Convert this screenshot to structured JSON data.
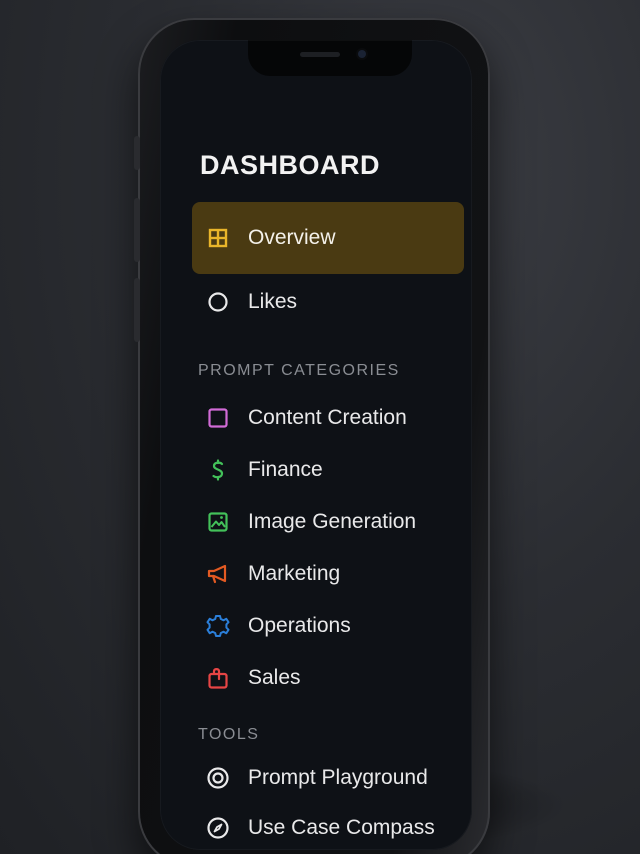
{
  "dashboard": {
    "title": "DASHBOARD"
  },
  "nav": {
    "items": [
      {
        "label": "Overview",
        "icon": "grid-icon",
        "active": true,
        "color": "#e9b52a"
      },
      {
        "label": "Likes",
        "icon": "circle-icon",
        "active": false,
        "color": "#e9e9ea"
      }
    ]
  },
  "categories": {
    "heading": "PROMPT CATEGORIES",
    "items": [
      {
        "label": "Content Creation",
        "icon": "square-icon",
        "color": "#d16bd6"
      },
      {
        "label": "Finance",
        "icon": "dollar-icon",
        "color": "#43c15a"
      },
      {
        "label": "Image Generation",
        "icon": "image-icon",
        "color": "#43c15a"
      },
      {
        "label": "Marketing",
        "icon": "megaphone-icon",
        "color": "#e35a22"
      },
      {
        "label": "Operations",
        "icon": "gear-icon",
        "color": "#2b7fd9"
      },
      {
        "label": "Sales",
        "icon": "bag-icon",
        "color": "#e64545"
      }
    ]
  },
  "tools": {
    "heading": "TOOLS",
    "items": [
      {
        "label": "Prompt Playground",
        "icon": "target-icon",
        "color": "#e9e9ea"
      },
      {
        "label": "Use Case Compass",
        "icon": "compass-icon",
        "color": "#e9e9ea"
      }
    ]
  }
}
